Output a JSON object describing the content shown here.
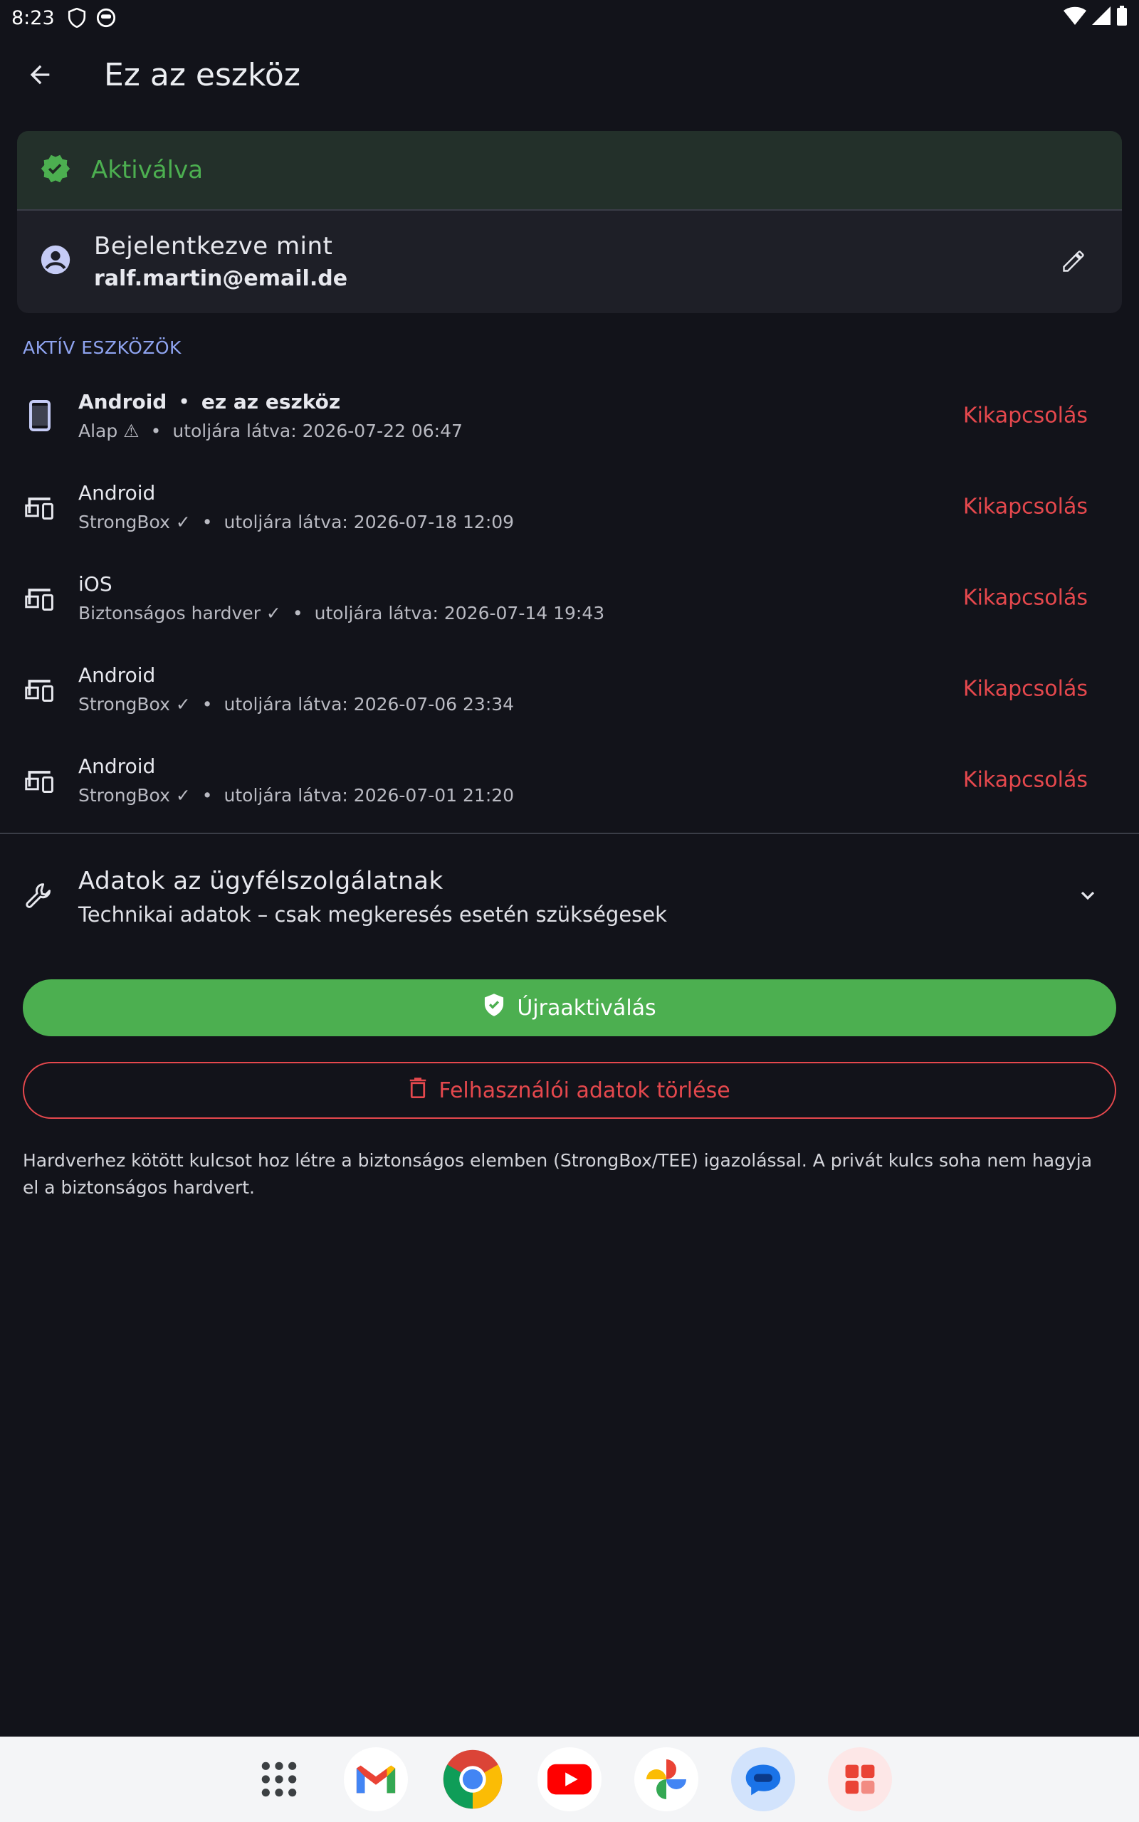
{
  "status_bar": {
    "time": "8:23"
  },
  "app_bar": {
    "title": "Ez az eszköz"
  },
  "status_card": {
    "activated_label": "Aktiválva",
    "logged_in_label": "Bejelentkezve mint",
    "email": "ralf.martin@email.de"
  },
  "section_header": "AKTÍV ESZKÖZÖK",
  "devices": [
    {
      "name": "Android",
      "this_device": "ez az eszköz",
      "security": "Alap ⚠",
      "last_seen": "utoljára látva: 2026-07-22 06:47",
      "action": "Kikapcsolás",
      "icon": "phone-icon"
    },
    {
      "name": "Android",
      "this_device": "",
      "security": "StrongBox ✓",
      "last_seen": "utoljára látva: 2026-07-18 12:09",
      "action": "Kikapcsolás",
      "icon": "devices-icon"
    },
    {
      "name": "iOS",
      "this_device": "",
      "security": "Biztonságos hardver ✓",
      "last_seen": "utoljára látva: 2026-07-14 19:43",
      "action": "Kikapcsolás",
      "icon": "devices-icon"
    },
    {
      "name": "Android",
      "this_device": "",
      "security": "StrongBox ✓",
      "last_seen": "utoljára látva: 2026-07-06 23:34",
      "action": "Kikapcsolás",
      "icon": "devices-icon"
    },
    {
      "name": "Android",
      "this_device": "",
      "security": "StrongBox ✓",
      "last_seen": "utoljára látva: 2026-07-01 21:20",
      "action": "Kikapcsolás",
      "icon": "devices-icon"
    }
  ],
  "support": {
    "title": "Adatok az ügyfélszolgálatnak",
    "subtitle": "Technikai adatok – csak megkeresés esetén szükségesek"
  },
  "buttons": {
    "reactivate": "Újraaktiválás",
    "delete": "Felhasználói adatok törlése"
  },
  "footnote": "Hardverhez kötött kulcsot hoz létre a biztonságos elemben (StrongBox/TEE) igazolással. A privát kulcs soha nem hagyja el a biztonságos hardvert.",
  "dock": [
    "app-drawer-icon",
    "gmail-icon",
    "chrome-icon",
    "youtube-icon",
    "photos-icon",
    "messages-icon",
    "play-games-icon"
  ],
  "colors": {
    "accent_green": "#4caf50",
    "danger_red": "#e5484d",
    "section_blue": "#8fa4f0",
    "background": "#12131a"
  }
}
